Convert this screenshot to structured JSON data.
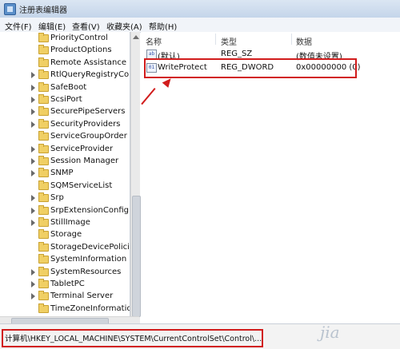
{
  "window": {
    "title": "注册表编辑器"
  },
  "menu": [
    {
      "label": "文件(F)"
    },
    {
      "label": "编辑(E)"
    },
    {
      "label": "查看(V)"
    },
    {
      "label": "收藏夹(A)"
    },
    {
      "label": "帮助(H)"
    }
  ],
  "tree": {
    "items": [
      {
        "label": "PriorityControl",
        "expandable": false
      },
      {
        "label": "ProductOptions",
        "expandable": false
      },
      {
        "label": "Remote Assistance",
        "expandable": false
      },
      {
        "label": "RtlQueryRegistryConf",
        "expandable": true
      },
      {
        "label": "SafeBoot",
        "expandable": true
      },
      {
        "label": "ScsiPort",
        "expandable": true
      },
      {
        "label": "SecurePipeServers",
        "expandable": true
      },
      {
        "label": "SecurityProviders",
        "expandable": true
      },
      {
        "label": "ServiceGroupOrder",
        "expandable": false
      },
      {
        "label": "ServiceProvider",
        "expandable": true
      },
      {
        "label": "Session Manager",
        "expandable": true
      },
      {
        "label": "SNMP",
        "expandable": true
      },
      {
        "label": "SQMServiceList",
        "expandable": false
      },
      {
        "label": "Srp",
        "expandable": true
      },
      {
        "label": "SrpExtensionConfig",
        "expandable": true
      },
      {
        "label": "StillImage",
        "expandable": true
      },
      {
        "label": "Storage",
        "expandable": false
      },
      {
        "label": "StorageDevicePolicies",
        "expandable": false
      },
      {
        "label": "SystemInformation",
        "expandable": false
      },
      {
        "label": "SystemResources",
        "expandable": true
      },
      {
        "label": "TabletPC",
        "expandable": true
      },
      {
        "label": "Terminal Server",
        "expandable": true
      },
      {
        "label": "TimeZoneInformation",
        "expandable": false
      }
    ]
  },
  "values": {
    "headers": {
      "name": "名称",
      "type": "类型",
      "data": "数据"
    },
    "rows": [
      {
        "icon": "ab",
        "name": "(默认)",
        "type": "REG_SZ",
        "data": "(数值未设置)"
      },
      {
        "icon": "dword",
        "name": "WriteProtect",
        "type": "REG_DWORD",
        "data": "0x00000000 (0)"
      }
    ]
  },
  "status": {
    "path": "计算机\\HKEY_LOCAL_MACHINE\\SYSTEM\\CurrentControlSet\\Control\\..."
  },
  "watermark": {
    "text": "jia"
  },
  "colors": {
    "annotation": "#d11c1c",
    "folder": "#f0cf64"
  }
}
